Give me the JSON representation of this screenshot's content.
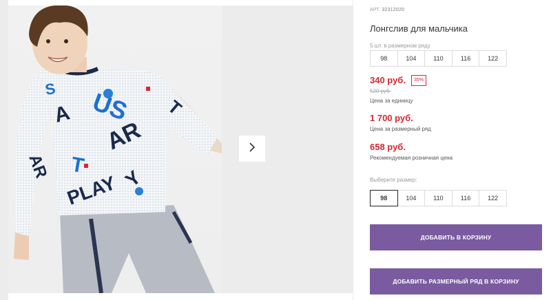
{
  "gallery": {
    "image_alt": "boy-in-printed-longsleeve",
    "next_icon": "chevron-right-icon"
  },
  "product": {
    "article_label": "АРТ.",
    "article_value": "32312020",
    "title": "Лонгслив для мальчика",
    "size_row_count_label": "5 шт. в размерном ряду",
    "size_row_sizes": [
      "98",
      "104",
      "110",
      "116",
      "122"
    ],
    "price_unit": "340 руб.",
    "discount": "35%",
    "old_price": "520 руб.",
    "price_unit_caption": "Цена за единицу",
    "price_row": "1 700 руб.",
    "price_row_caption": "Цена за размерный ряд",
    "price_rrp": "658 руб.",
    "price_rrp_caption": "Рекомендуемая розничная цена",
    "choose_size_label": "Выберите размер:",
    "choose_sizes": [
      "98",
      "104",
      "110",
      "116",
      "122"
    ],
    "selected_size": "98",
    "add_to_cart": "ДОБАВИТЬ В КОРЗИНУ",
    "add_row_to_cart": "ДОБАВИТЬ РАЗМЕРНЫЙ РЯД В КОРЗИНУ"
  },
  "colors": {
    "accent_button": "#7a5b9f",
    "price_red": "#d6282f"
  }
}
